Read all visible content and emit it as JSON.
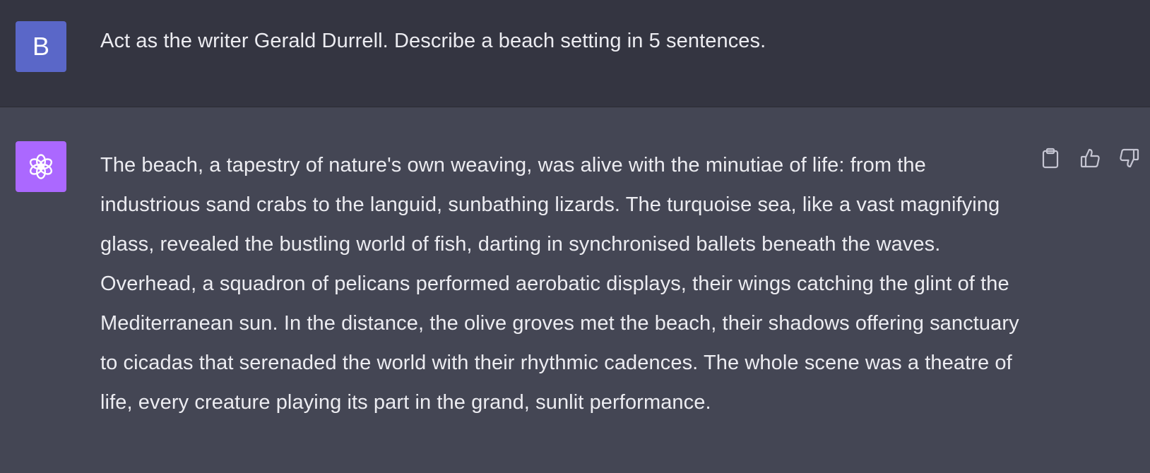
{
  "user_turn": {
    "avatar_initial": "B",
    "avatar_color": "#5a67c8",
    "text": "Act as the writer Gerald Durrell. Describe a beach setting in 5 sentences."
  },
  "assistant_turn": {
    "avatar_icon": "openai-logo-icon",
    "avatar_color": "#ab68ff",
    "text": "The beach, a tapestry of nature's own weaving, was alive with the minutiae of life: from the industrious sand crabs to the languid, sunbathing lizards. The turquoise sea, like a vast magnifying glass, revealed the bustling world of fish, darting in synchronised ballets beneath the waves. Overhead, a squadron of pelicans performed aerobatic displays, their wings catching the glint of the Mediterranean sun. In the distance, the olive groves met the beach, their shadows offering sanctuary to cicadas that serenaded the world with their rhythmic cadences. The whole scene was a theatre of life, every creature playing its part in the grand, sunlit performance.",
    "actions": [
      {
        "icon": "clipboard-icon"
      },
      {
        "icon": "thumbs-up-icon"
      },
      {
        "icon": "thumbs-down-icon"
      }
    ]
  },
  "colors": {
    "user_bg": "#343541",
    "assistant_bg": "#444654",
    "text": "#ececf1",
    "icon": "#c5c5d2"
  }
}
